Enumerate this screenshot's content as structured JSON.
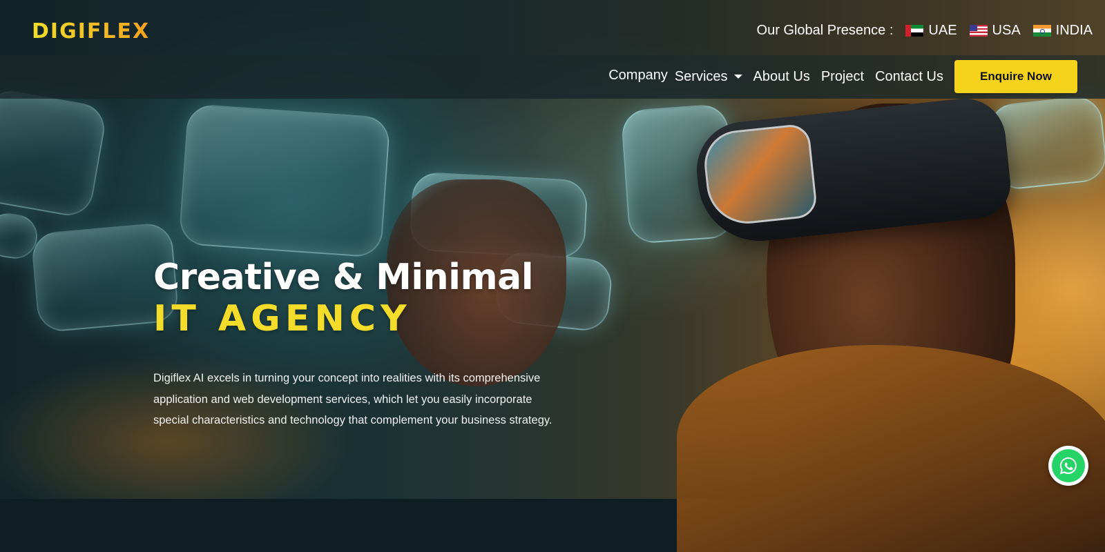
{
  "header": {
    "logo_text": "DIGIFLEX",
    "presence_label": "Our Global Presence :",
    "countries": [
      {
        "label": "UAE",
        "flag": "uae-flag-icon"
      },
      {
        "label": "USA",
        "flag": "usa-flag-icon"
      },
      {
        "label": "INDIA",
        "flag": "india-flag-icon"
      }
    ]
  },
  "nav": {
    "company": "Company",
    "services": "Services",
    "about": "About Us",
    "project": "Project",
    "contact": "Contact Us",
    "cta": "Enquire Now"
  },
  "hero": {
    "title_line1": "Creative & Minimal",
    "title_line2": "IT AGENCY",
    "description": "Digiflex AI excels in turning your concept into realities with its comprehensive application and web development services, which let you easily incorporate special characteristics and technology that complement your business strategy."
  },
  "colors": {
    "accent_yellow": "#f5d21c",
    "logo_gradient_start": "#f2dd2a",
    "logo_gradient_end": "#f5a321",
    "whatsapp_green": "#25d366"
  },
  "floating": {
    "whatsapp_icon": "whatsapp-icon"
  }
}
